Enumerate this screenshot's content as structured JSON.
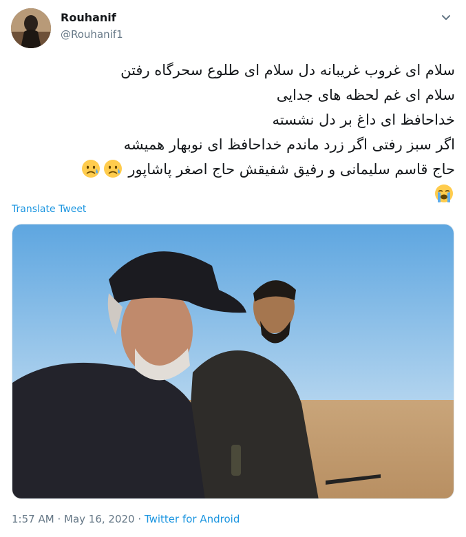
{
  "user": {
    "display_name": "Rouhanif",
    "handle": "@Rouhanif1",
    "avatar_icon": "profile-avatar"
  },
  "menu_icon": "chevron-down-icon",
  "tweet": {
    "lines": [
      "سلام ای غروب غریبانه دل سلام ای طلوع سحرگاه رفتن",
      "سلام ای غم لحظه های جدایی",
      "خداحافظ ای داغ بر دل نشسته",
      "اگر سبز رفتی اگر زرد ماندم خداحافظ ای نوبهار همیشه",
      "حاج قاسم سلیمانی و رفیق شفیقش حاج اصغر پاشاپور"
    ],
    "emoji_after_line_5": [
      "sad-but-relieved-face",
      "sad-but-relieved-face"
    ],
    "emoji_last_line": [
      "loudly-crying-face"
    ]
  },
  "translate_label": "Translate Tweet",
  "media": {
    "description_icon": "photo-two-men-in-desert"
  },
  "footer": {
    "time": "1:57 AM",
    "separator": "·",
    "date": "May 16, 2020",
    "source": "Twitter for Android"
  },
  "colors": {
    "link": "#1b95e0",
    "muted": "#657786",
    "text": "#14171a"
  }
}
